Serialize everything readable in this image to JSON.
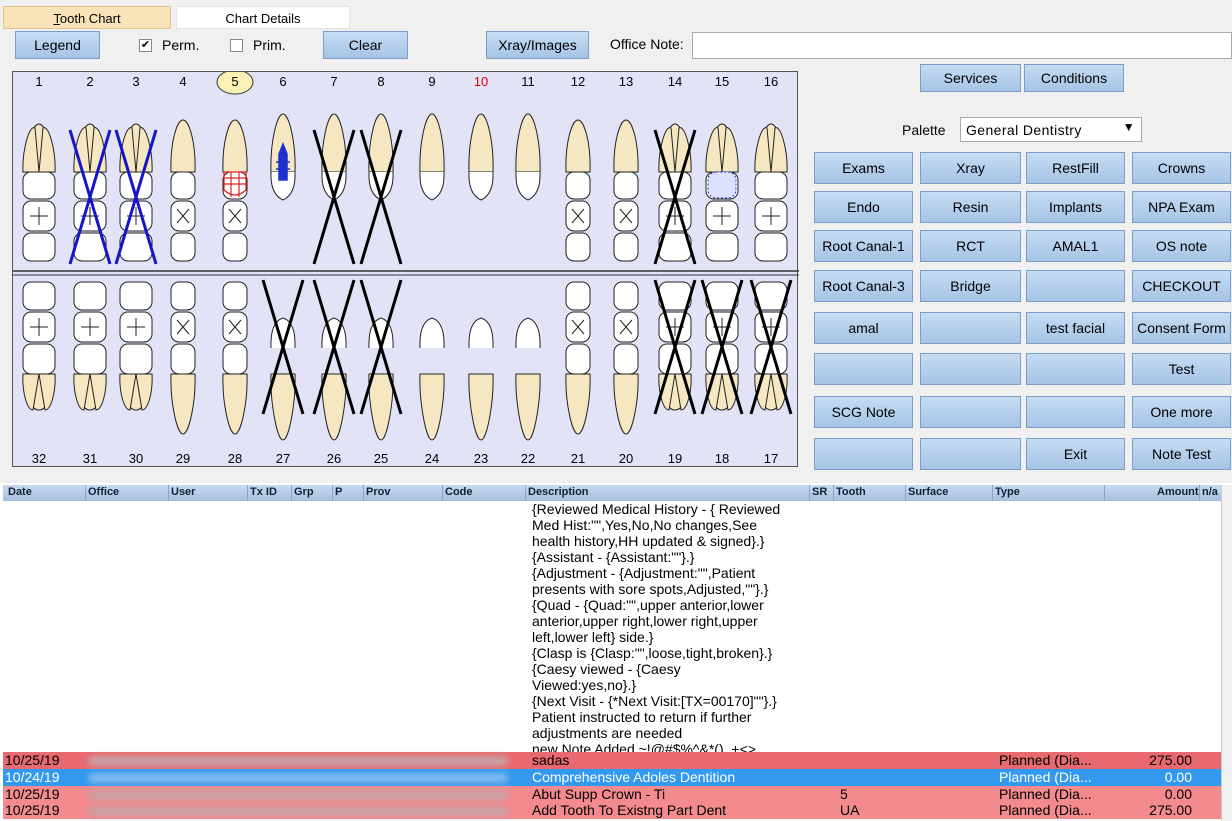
{
  "tabs": {
    "tooth_chart": "Tooth Chart",
    "chart_details": "Chart Details"
  },
  "toolbar": {
    "legend": "Legend",
    "perm": "Perm.",
    "perm_checked": "✔",
    "prim": "Prim.",
    "clear": "Clear",
    "xray": "Xray/Images",
    "office_note_label": "Office Note:",
    "office_note_value": ""
  },
  "teeth": {
    "upper_numbers": [
      "1",
      "2",
      "3",
      "4",
      "5",
      "6",
      "7",
      "8",
      "9",
      "10",
      "11",
      "12",
      "13",
      "14",
      "15",
      "16"
    ],
    "lower_numbers": [
      "32",
      "31",
      "30",
      "29",
      "28",
      "27",
      "26",
      "25",
      "24",
      "23",
      "22",
      "21",
      "20",
      "19",
      "18",
      "17"
    ],
    "selected_tooth": "5",
    "red_number_tooth": "10",
    "missing_blue": [
      "2",
      "3"
    ],
    "missing_black": [
      "7",
      "8",
      "14",
      "27",
      "26",
      "25",
      "19",
      "18",
      "17"
    ],
    "colors": {
      "blue_x": "#1414c8",
      "black_x": "#000000",
      "crown_red": "#e02020",
      "implant_blue": "#2030d0",
      "tooth_fill": "#f4e7c1",
      "chart_bg": "#e3e3f8"
    }
  },
  "panel": {
    "services": "Services",
    "conditions": "Conditions",
    "palette_label": "Palette",
    "palette_value": "General Dentistry",
    "buttons": [
      [
        "Exams",
        "Xray",
        "RestFill",
        "Crowns"
      ],
      [
        "Endo",
        "Resin",
        "Implants",
        "NPA Exam"
      ],
      [
        "Root Canal-1",
        "RCT",
        "AMAL1",
        "OS note"
      ],
      [
        "Root Canal-3",
        "Bridge",
        "",
        "CHECKOUT"
      ],
      [
        "amal",
        "",
        "test facial",
        "Consent Form"
      ],
      [
        "",
        "",
        "",
        "Test"
      ],
      [
        "SCG Note",
        "",
        "",
        "One more"
      ],
      [
        "",
        "",
        "Exit",
        "Note Test"
      ]
    ]
  },
  "grid": {
    "columns": [
      "Date",
      "Office",
      "User",
      "Tx ID",
      "Grp",
      "P",
      "Prov",
      "Code",
      "Description",
      "SR",
      "Tooth",
      "Surface",
      "Type",
      "Amount",
      "n/a"
    ],
    "note_text": "{Reviewed Medical History - { Reviewed\nMed Hist:\"\",Yes,No,No changes,See\nhealth history,HH updated & signed}.}\n{Assistant - {Assistant:\"\"}.}\n{Adjustment - {Adjustment:\"\",Patient\npresents with sore spots,Adjusted,\"\"}.}\n{Quad - {Quad:\"\",upper anterior,lower\nanterior,upper right,lower right,upper\nleft,lower left} side.}\n{Clasp is {Clasp:\"\",loose,tight,broken}.}\n{Caesy viewed - {Caesy\nViewed:yes,no}.}\n{Next Visit - {*Next Visit:[TX=00170]\"\"}.}\nPatient instructed to return if further\nadjustments are needed\nnew Note Added ~!@#$%^&*()_+<>,",
    "rows": [
      {
        "date": "10/25/19",
        "description": "sadas",
        "tooth": "",
        "type": "Planned (Dia...",
        "amount": "275.00",
        "bg": "#e86a70",
        "color": "#000"
      },
      {
        "date": "10/24/19",
        "description": "Comprehensive Adoles Dentition",
        "tooth": "",
        "type": "Planned (Dia...",
        "amount": "0.00",
        "bg": "#3399ee",
        "color": "#ffffff"
      },
      {
        "date": "10/25/19",
        "description": "Abut Supp Crown - Ti",
        "tooth": "5",
        "type": "Planned (Dia...",
        "amount": "0.00",
        "bg": "#f28a8e",
        "color": "#000"
      },
      {
        "date": "10/25/19",
        "description": "Add Tooth To Existng Part Dent",
        "tooth": "UA",
        "type": "Planned (Dia...",
        "amount": "275.00",
        "bg": "#f28a8e",
        "color": "#000"
      }
    ]
  }
}
